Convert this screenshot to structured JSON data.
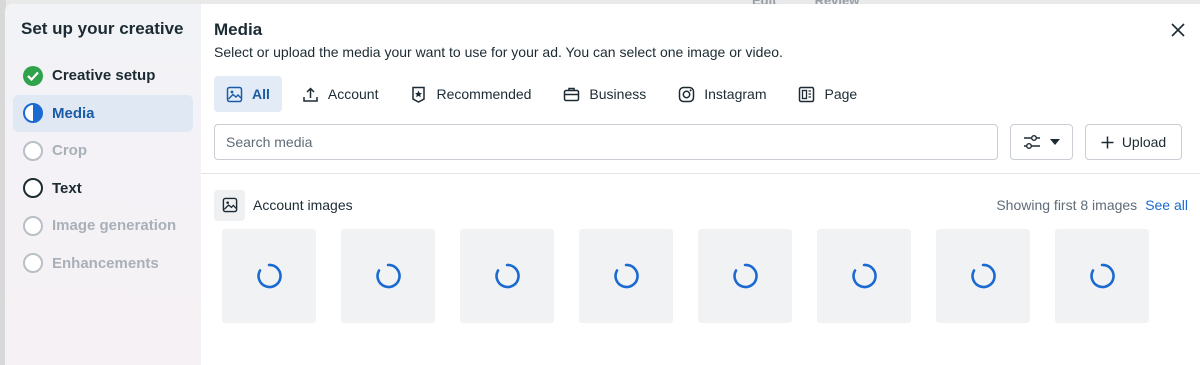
{
  "background": {
    "items": [
      "Edit",
      "Review"
    ]
  },
  "sidebar": {
    "title": "Set up your creative",
    "steps": [
      {
        "label": "Creative setup",
        "state": "done"
      },
      {
        "label": "Media",
        "state": "active"
      },
      {
        "label": "Crop",
        "state": "disabled"
      },
      {
        "label": "Text",
        "state": "pending"
      },
      {
        "label": "Image generation",
        "state": "disabled"
      },
      {
        "label": "Enhancements",
        "state": "disabled"
      }
    ]
  },
  "main": {
    "title": "Media",
    "subtitle": "Select or upload the media your want to use for your ad. You can select one image or video.",
    "tabs": [
      {
        "label": "All",
        "icon": "image-icon",
        "selected": true
      },
      {
        "label": "Account",
        "icon": "upload-arrow-icon"
      },
      {
        "label": "Recommended",
        "icon": "badge-star-icon"
      },
      {
        "label": "Business",
        "icon": "briefcase-icon"
      },
      {
        "label": "Instagram",
        "icon": "instagram-icon"
      },
      {
        "label": "Page",
        "icon": "page-icon"
      }
    ],
    "search": {
      "placeholder": "Search media",
      "value": ""
    },
    "filter": {
      "icon": "sliders-icon",
      "caret": "caret-down-icon"
    },
    "upload_label": "Upload",
    "section": {
      "title": "Account images",
      "count_text": "Showing first 8 images",
      "see_all": "See all"
    },
    "tiles_count": 8
  },
  "colors": {
    "accent": "#1b6ad1",
    "success": "#31a24c",
    "tab_selected_bg": "#e2ebf6"
  }
}
